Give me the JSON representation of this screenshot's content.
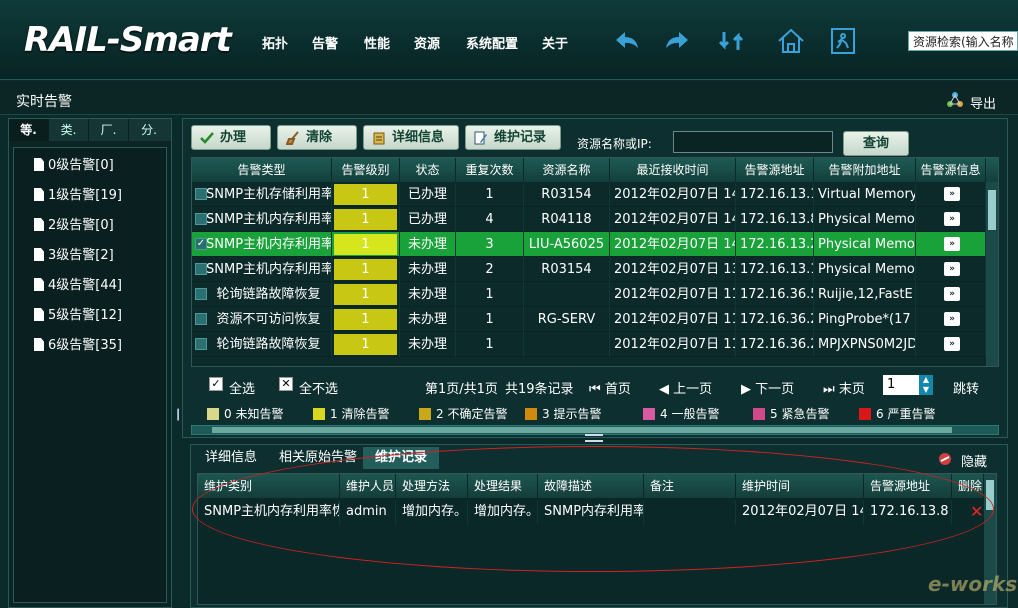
{
  "app": {
    "logo": "RAIL-Smart",
    "menu": [
      "拓扑",
      "告警",
      "性能",
      "资源",
      "系统配置",
      "关于"
    ],
    "toolbar_icons": [
      "back-arrow-icon",
      "forward-arrow-icon",
      "refresh-icon",
      "home-icon",
      "exit-icon"
    ],
    "search_placeholder": "资源检索(输入名称"
  },
  "page": {
    "title": "实时告警",
    "export_label": "导出"
  },
  "left": {
    "tabs": [
      "等.",
      "类.",
      "厂.",
      "分."
    ],
    "active_tab": 0,
    "levels": [
      "0级告警[0]",
      "1级告警[19]",
      "2级告警[0]",
      "3级告警[2]",
      "4级告警[44]",
      "5级告警[12]",
      "6级告警[35]"
    ]
  },
  "toolbar": {
    "handle": "办理",
    "clear": "清除",
    "details": "详细信息",
    "maintenance": "维护记录",
    "resource_label": "资源名称或IP:",
    "resource_value": "",
    "query": "查询"
  },
  "grid": {
    "headers": [
      "告警类型",
      "告警级别",
      "状态",
      "重复次数",
      "资源名称",
      "最近接收时间",
      "告警源地址",
      "告警附加地址",
      "告警源信息"
    ],
    "rows": [
      {
        "type": "SNMP主机存储利用率",
        "level": "1",
        "status": "已办理",
        "repeat": "1",
        "resource": "R03154",
        "time": "2012年02月07日 14",
        "src": "172.16.13.1",
        "extra": "Virtual Memory",
        "info": "»",
        "checked": false,
        "selected": false
      },
      {
        "type": "SNMP主机内存利用率",
        "level": "1",
        "status": "已办理",
        "repeat": "4",
        "resource": "R04118",
        "time": "2012年02月07日 14",
        "src": "172.16.13.8",
        "extra": "Physical Memor",
        "info": "»",
        "checked": false,
        "selected": false
      },
      {
        "type": "SNMP主机内存利用率",
        "level": "1",
        "status": "未办理",
        "repeat": "3",
        "resource": "LIU-A56025",
        "time": "2012年02月07日 14",
        "src": "172.16.13.2",
        "extra": "Physical Memor",
        "info": "»",
        "checked": true,
        "selected": true
      },
      {
        "type": "SNMP主机内存利用率",
        "level": "1",
        "status": "未办理",
        "repeat": "2",
        "resource": "R03154",
        "time": "2012年02月07日 13",
        "src": "172.16.13.1",
        "extra": "Physical Memor",
        "info": "»",
        "checked": false,
        "selected": false
      },
      {
        "type": "轮询链路故障恢复",
        "level": "1",
        "status": "未办理",
        "repeat": "1",
        "resource": "",
        "time": "2012年02月07日 11",
        "src": "172.16.36.5",
        "extra": "Ruijie,12,FastE",
        "info": "»",
        "checked": false,
        "selected": false
      },
      {
        "type": "资源不可访问恢复",
        "level": "1",
        "status": "未办理",
        "repeat": "1",
        "resource": "RG-SERV",
        "time": "2012年02月07日 11",
        "src": "172.16.36.2",
        "extra": "PingProbe*(17",
        "info": "»",
        "checked": false,
        "selected": false
      },
      {
        "type": "轮询链路故障恢复",
        "level": "1",
        "status": "未办理",
        "repeat": "1",
        "resource": "",
        "time": "2012年02月07日 11",
        "src": "172.16.36.2",
        "extra": "MPJXPNS0M2JD",
        "info": "»",
        "checked": false,
        "selected": false
      }
    ]
  },
  "pager": {
    "select_all": "全选",
    "select_none": "全不选",
    "page_info": "第1页/共1页",
    "total": "共19条记录",
    "first": "首页",
    "prev": "上一页",
    "next": "下一页",
    "last": "末页",
    "page_value": "1",
    "jump": "跳转"
  },
  "legend": [
    {
      "label": "0 未知告警",
      "color": "#d8d88a"
    },
    {
      "label": "1 清除告警",
      "color": "#d8d820"
    },
    {
      "label": "2 不确定告警",
      "color": "#c9a81a"
    },
    {
      "label": "3 提示告警",
      "color": "#d08a10"
    },
    {
      "label": "4 一般告警",
      "color": "#d85aa0"
    },
    {
      "label": "5 紧急告警",
      "color": "#d04a8a"
    },
    {
      "label": "6 严重告警",
      "color": "#d81818"
    }
  ],
  "bottom": {
    "tabs": [
      "详细信息",
      "相关原始告警",
      "维护记录"
    ],
    "active_tab": 2,
    "hide_label": "隐藏",
    "headers": [
      "维护类别",
      "维护人员",
      "处理方法",
      "处理结果",
      "故障描述",
      "备注",
      "维护时间",
      "告警源地址",
      "删除"
    ],
    "row": {
      "category": "SNMP主机内存利用率恢",
      "person": "admin",
      "method": "增加内存。",
      "result": "增加内存。",
      "desc": "SNMP内存利用率",
      "note": "",
      "time": "2012年02月07日 14",
      "src": "172.16.13.8",
      "delete": "✕"
    }
  },
  "colors": {
    "selected_row": "#1aa23a",
    "severity_bar": "#c8c814",
    "highlight_ellipse": "#d62020"
  }
}
